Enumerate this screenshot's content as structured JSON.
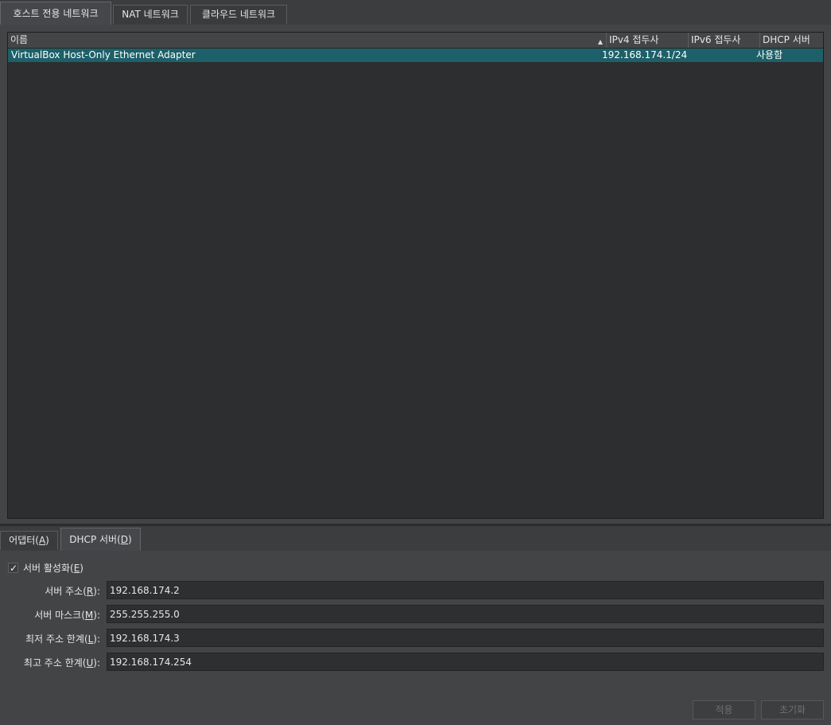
{
  "top_tabs": [
    {
      "label": "호스트 전용 네트워크",
      "active": true
    },
    {
      "label": "NAT 네트워크",
      "active": false
    },
    {
      "label": "클라우드 네트워크",
      "active": false
    }
  ],
  "network_table": {
    "columns": [
      "이름",
      "IPv4 접두사",
      "IPv6 접두사",
      "DHCP 서버"
    ],
    "sorted_column": "이름",
    "sort_order": "ascending",
    "rows": [
      {
        "name": "VirtualBox Host-Only Ethernet Adapter",
        "ipv4": "192.168.174.1/24",
        "ipv6": "",
        "dhcp": "사용함",
        "selected": true
      }
    ]
  },
  "bottom_tabs": [
    {
      "label": "어댑터",
      "mnemonic": "A",
      "active": false
    },
    {
      "label": "DHCP 서버",
      "mnemonic": "D",
      "active": true
    }
  ],
  "dhcp": {
    "enable_label": "서버 활성화",
    "enable_mnemonic": "E",
    "enabled": true,
    "fields": [
      {
        "label": "서버 주소",
        "mnemonic": "R",
        "value": "192.168.174.2"
      },
      {
        "label": "서버 마스크",
        "mnemonic": "M",
        "value": "255.255.255.0"
      },
      {
        "label": "최저 주소 한계",
        "mnemonic": "L",
        "value": "192.168.174.3"
      },
      {
        "label": "최고 주소 한계",
        "mnemonic": "U",
        "value": "192.168.174.254"
      }
    ]
  },
  "buttons": {
    "apply": "적용",
    "reset": "초기화"
  },
  "colors": {
    "selection": "#1d6069",
    "panel": "#434446",
    "table_bg": "#2d2e30"
  }
}
